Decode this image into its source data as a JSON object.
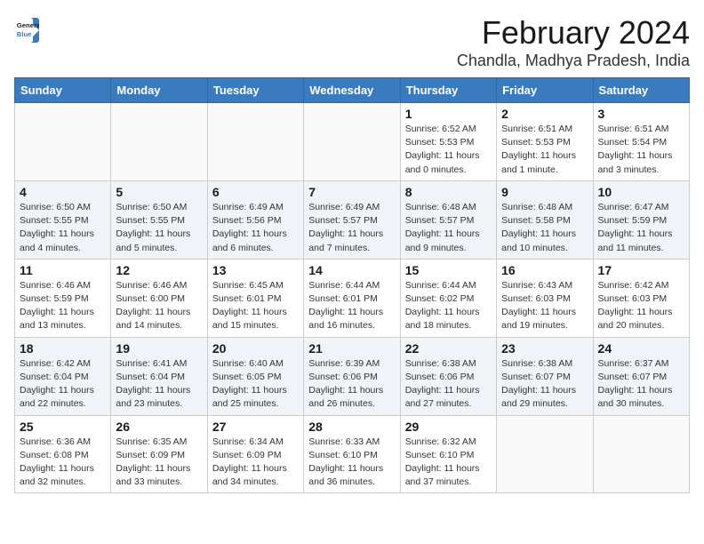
{
  "logo": {
    "line1": "General",
    "line2": "Blue"
  },
  "title": "February 2024",
  "location": "Chandla, Madhya Pradesh, India",
  "weekdays": [
    "Sunday",
    "Monday",
    "Tuesday",
    "Wednesday",
    "Thursday",
    "Friday",
    "Saturday"
  ],
  "weeks": [
    [
      {
        "day": "",
        "info": ""
      },
      {
        "day": "",
        "info": ""
      },
      {
        "day": "",
        "info": ""
      },
      {
        "day": "",
        "info": ""
      },
      {
        "day": "1",
        "info": "Sunrise: 6:52 AM\nSunset: 5:53 PM\nDaylight: 11 hours\nand 0 minutes."
      },
      {
        "day": "2",
        "info": "Sunrise: 6:51 AM\nSunset: 5:53 PM\nDaylight: 11 hours\nand 1 minute."
      },
      {
        "day": "3",
        "info": "Sunrise: 6:51 AM\nSunset: 5:54 PM\nDaylight: 11 hours\nand 3 minutes."
      }
    ],
    [
      {
        "day": "4",
        "info": "Sunrise: 6:50 AM\nSunset: 5:55 PM\nDaylight: 11 hours\nand 4 minutes."
      },
      {
        "day": "5",
        "info": "Sunrise: 6:50 AM\nSunset: 5:55 PM\nDaylight: 11 hours\nand 5 minutes."
      },
      {
        "day": "6",
        "info": "Sunrise: 6:49 AM\nSunset: 5:56 PM\nDaylight: 11 hours\nand 6 minutes."
      },
      {
        "day": "7",
        "info": "Sunrise: 6:49 AM\nSunset: 5:57 PM\nDaylight: 11 hours\nand 7 minutes."
      },
      {
        "day": "8",
        "info": "Sunrise: 6:48 AM\nSunset: 5:57 PM\nDaylight: 11 hours\nand 9 minutes."
      },
      {
        "day": "9",
        "info": "Sunrise: 6:48 AM\nSunset: 5:58 PM\nDaylight: 11 hours\nand 10 minutes."
      },
      {
        "day": "10",
        "info": "Sunrise: 6:47 AM\nSunset: 5:59 PM\nDaylight: 11 hours\nand 11 minutes."
      }
    ],
    [
      {
        "day": "11",
        "info": "Sunrise: 6:46 AM\nSunset: 5:59 PM\nDaylight: 11 hours\nand 13 minutes."
      },
      {
        "day": "12",
        "info": "Sunrise: 6:46 AM\nSunset: 6:00 PM\nDaylight: 11 hours\nand 14 minutes."
      },
      {
        "day": "13",
        "info": "Sunrise: 6:45 AM\nSunset: 6:01 PM\nDaylight: 11 hours\nand 15 minutes."
      },
      {
        "day": "14",
        "info": "Sunrise: 6:44 AM\nSunset: 6:01 PM\nDaylight: 11 hours\nand 16 minutes."
      },
      {
        "day": "15",
        "info": "Sunrise: 6:44 AM\nSunset: 6:02 PM\nDaylight: 11 hours\nand 18 minutes."
      },
      {
        "day": "16",
        "info": "Sunrise: 6:43 AM\nSunset: 6:03 PM\nDaylight: 11 hours\nand 19 minutes."
      },
      {
        "day": "17",
        "info": "Sunrise: 6:42 AM\nSunset: 6:03 PM\nDaylight: 11 hours\nand 20 minutes."
      }
    ],
    [
      {
        "day": "18",
        "info": "Sunrise: 6:42 AM\nSunset: 6:04 PM\nDaylight: 11 hours\nand 22 minutes."
      },
      {
        "day": "19",
        "info": "Sunrise: 6:41 AM\nSunset: 6:04 PM\nDaylight: 11 hours\nand 23 minutes."
      },
      {
        "day": "20",
        "info": "Sunrise: 6:40 AM\nSunset: 6:05 PM\nDaylight: 11 hours\nand 25 minutes."
      },
      {
        "day": "21",
        "info": "Sunrise: 6:39 AM\nSunset: 6:06 PM\nDaylight: 11 hours\nand 26 minutes."
      },
      {
        "day": "22",
        "info": "Sunrise: 6:38 AM\nSunset: 6:06 PM\nDaylight: 11 hours\nand 27 minutes."
      },
      {
        "day": "23",
        "info": "Sunrise: 6:38 AM\nSunset: 6:07 PM\nDaylight: 11 hours\nand 29 minutes."
      },
      {
        "day": "24",
        "info": "Sunrise: 6:37 AM\nSunset: 6:07 PM\nDaylight: 11 hours\nand 30 minutes."
      }
    ],
    [
      {
        "day": "25",
        "info": "Sunrise: 6:36 AM\nSunset: 6:08 PM\nDaylight: 11 hours\nand 32 minutes."
      },
      {
        "day": "26",
        "info": "Sunrise: 6:35 AM\nSunset: 6:09 PM\nDaylight: 11 hours\nand 33 minutes."
      },
      {
        "day": "27",
        "info": "Sunrise: 6:34 AM\nSunset: 6:09 PM\nDaylight: 11 hours\nand 34 minutes."
      },
      {
        "day": "28",
        "info": "Sunrise: 6:33 AM\nSunset: 6:10 PM\nDaylight: 11 hours\nand 36 minutes."
      },
      {
        "day": "29",
        "info": "Sunrise: 6:32 AM\nSunset: 6:10 PM\nDaylight: 11 hours\nand 37 minutes."
      },
      {
        "day": "",
        "info": ""
      },
      {
        "day": "",
        "info": ""
      }
    ]
  ]
}
